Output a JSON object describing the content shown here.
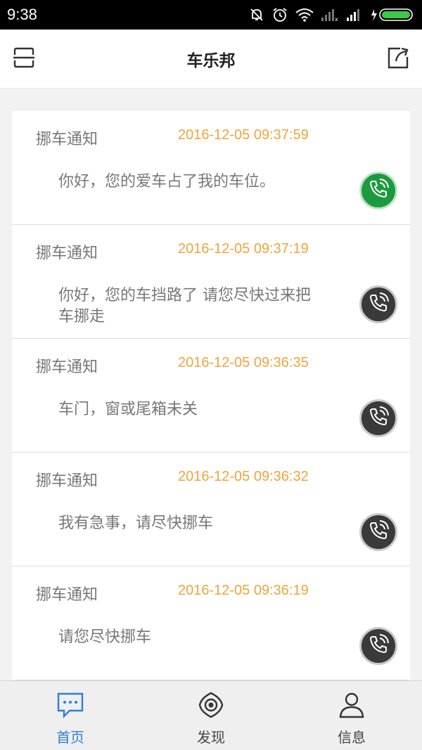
{
  "status_bar": {
    "time": "9:38"
  },
  "header": {
    "title": "车乐邦"
  },
  "notifications": [
    {
      "type": "挪车通知",
      "time": "2016-12-05 09:37:59",
      "message": "你好，您的爱车占了我的车位。",
      "call_state": "active"
    },
    {
      "type": "挪车通知",
      "time": "2016-12-05 09:37:19",
      "message": "你好，您的车挡路了 请您尽快过来把车挪走",
      "call_state": "idle"
    },
    {
      "type": "挪车通知",
      "time": "2016-12-05 09:36:35",
      "message": "车门，窗或尾箱未关",
      "call_state": "idle"
    },
    {
      "type": "挪车通知",
      "time": "2016-12-05 09:36:32",
      "message": "我有急事，请尽快挪车",
      "call_state": "idle"
    },
    {
      "type": "挪车通知",
      "time": "2016-12-05 09:36:19",
      "message": "请您尽快挪车",
      "call_state": "idle"
    }
  ],
  "tabs": [
    {
      "label": "首页",
      "icon": "chat-bubble-icon",
      "active": true
    },
    {
      "label": "发现",
      "icon": "eye-icon",
      "active": false
    },
    {
      "label": "信息",
      "icon": "user-icon",
      "active": false
    }
  ],
  "colors": {
    "accent": "#2f7fd6",
    "timestamp": "#f0a43a",
    "call_active": "#1c9b3e",
    "call_idle": "#3a3a3a"
  }
}
